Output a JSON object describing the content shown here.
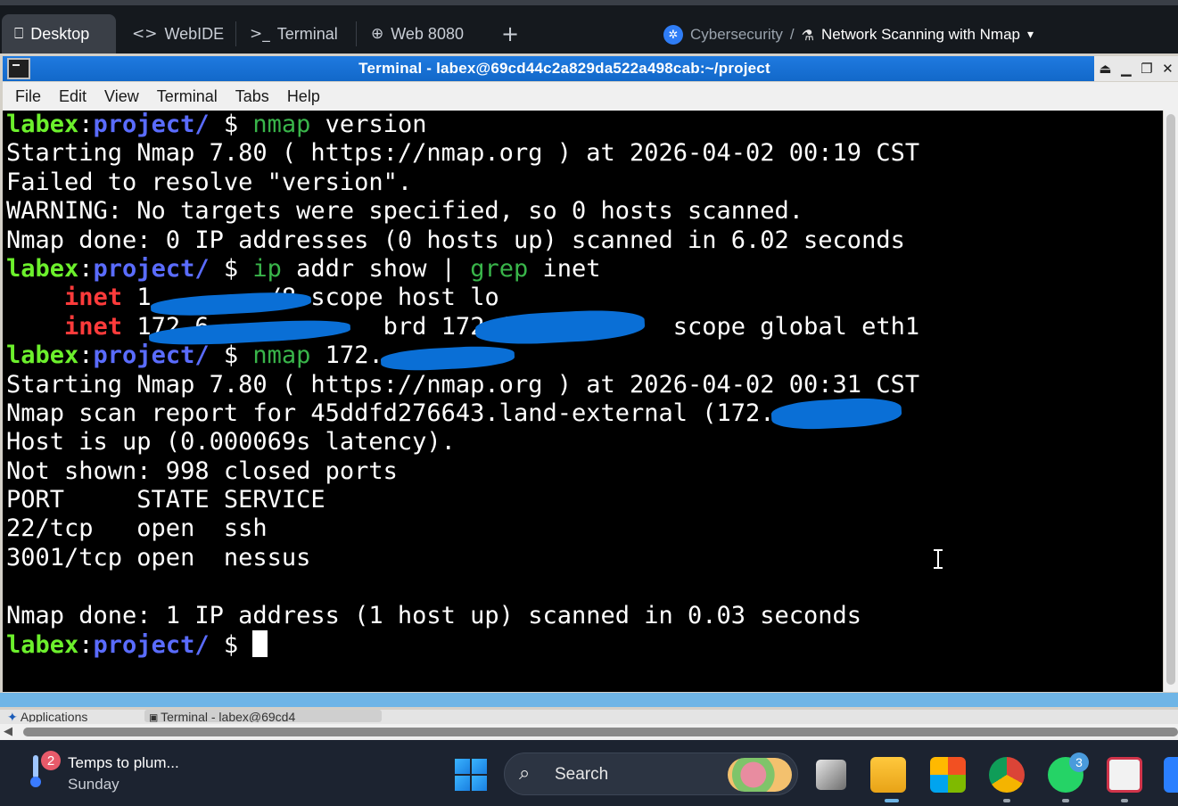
{
  "browser_tabs": [
    {
      "label": "Desktop",
      "icon": "monitor-icon",
      "glyph": "⎕"
    },
    {
      "label": "WebIDE",
      "icon": "code-icon",
      "glyph": "<>"
    },
    {
      "label": "Terminal",
      "icon": "terminal-icon",
      "glyph": ">_"
    },
    {
      "label": "Web 8080",
      "icon": "globe-icon",
      "glyph": "⊕"
    }
  ],
  "breadcrumb": {
    "category": "Cybersecurity",
    "separator": "/",
    "lab_title": "Network Scanning with Nmap"
  },
  "window": {
    "title": "Terminal - labex@69cd44c2a829da522a498cab:~/project"
  },
  "menu": [
    "File",
    "Edit",
    "View",
    "Terminal",
    "Tabs",
    "Help"
  ],
  "terminal": {
    "prompt_user": "labex",
    "prompt_dir": "project/",
    "prompt_symbol": "$",
    "lines": {
      "l1_cmd": "nmap",
      "l1_args": " version",
      "l2": "Starting Nmap 7.80 ( https://nmap.org ) at 2026-04-02 00:19 CST",
      "l3": "Failed to resolve \"version\".",
      "l4": "WARNING: No targets were specified, so 0 hosts scanned.",
      "l5": "Nmap done: 0 IP addresses (0 hosts up) scanned in 6.02 seconds",
      "l6_cmd1": "ip",
      "l6_mid": " addr show | ",
      "l6_cmd2": "grep",
      "l6_end": " inet",
      "l7_kw": "inet",
      "l7_rest": " 1        /8 scope host lo",
      "l8_kw": "inet",
      "l8_rest": " 172.6            brd 172.6           scope global eth1",
      "l9_cmd": "nmap",
      "l9_args": " 172.",
      "l10": "Starting Nmap 7.80 ( https://nmap.org ) at 2026-04-02 00:31 CST",
      "l11": "Nmap scan report for 45ddfd276643.land-external (172.",
      "l12": "Host is up (0.000069s latency).",
      "l13": "Not shown: 998 closed ports",
      "l14": "PORT     STATE SERVICE",
      "l15": "22/tcp   open  ssh",
      "l16": "3001/tcp open  nessus",
      "l17": "",
      "l18": "Nmap done: 1 IP address (1 host up) scanned in 0.03 seconds"
    }
  },
  "vnc_taskbar": {
    "item1": "Applications",
    "item2": "Terminal - labex@69cd4"
  },
  "windows_taskbar": {
    "weather_badge": "2",
    "weather_title": "Temps to plum...",
    "weather_sub": "Sunday",
    "search_label": "Search",
    "whatsapp_badge": "3"
  },
  "colors": {
    "prompt_user": "#6cf02c",
    "prompt_dir": "#5a6cff",
    "command": "#39b54a",
    "keyword": "#ff3b3b",
    "titlebar": "#1268c9",
    "redaction": "#0a6fd6"
  }
}
